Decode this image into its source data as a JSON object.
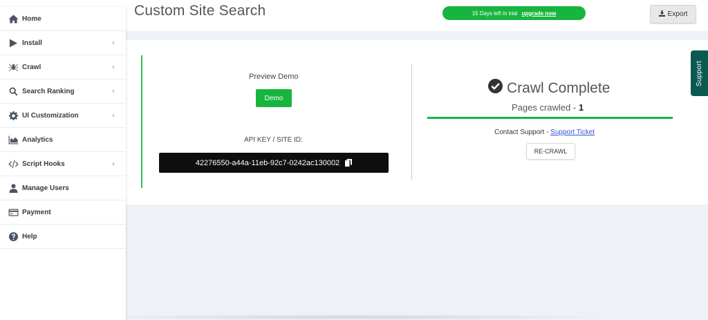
{
  "sidebar": {
    "items": [
      {
        "label": "Home",
        "icon": "home-icon",
        "chevron": ""
      },
      {
        "label": "Install",
        "icon": "play-icon",
        "chevron": "‹"
      },
      {
        "label": "Crawl",
        "icon": "spider-icon",
        "chevron": "‹"
      },
      {
        "label": "Search Ranking",
        "icon": "search-icon",
        "chevron": "‹"
      },
      {
        "label": "UI Customization",
        "icon": "gear-icon",
        "chevron": "‹"
      },
      {
        "label": "Analytics",
        "icon": "chart-icon",
        "chevron": ""
      },
      {
        "label": "Script Hooks",
        "icon": "code-icon",
        "chevron": "‹"
      },
      {
        "label": "Manage Users",
        "icon": "user-icon",
        "chevron": ""
      },
      {
        "label": "Payment",
        "icon": "credit-card-icon",
        "chevron": ""
      },
      {
        "label": "Help",
        "icon": "question-icon",
        "chevron": ""
      }
    ]
  },
  "header": {
    "title": "Custom Site Search",
    "trial_text": "15 Days left in trial",
    "upgrade_label": "upgrade now",
    "export_label": "Export"
  },
  "preview": {
    "label": "Preview Demo",
    "demo_button": "Demo"
  },
  "api": {
    "label": "API KEY / SITE ID:",
    "key": "42276550-a44a-11eb-92c7-0242ac130002"
  },
  "crawl": {
    "status": "Crawl Complete",
    "pages_label": "Pages crawled - ",
    "pages_count": "1",
    "progress": 1.0,
    "contact_label": "Contact Support - ",
    "support_link": "Support Ticket",
    "recrawl_button": "RE-CRAWL"
  },
  "support_tab": {
    "label": "Support"
  },
  "colors": {
    "accent_green": "#18b53e",
    "support_teal": "#0a5a52",
    "link_blue": "#3355dd",
    "main_bg": "#eef1f6"
  }
}
